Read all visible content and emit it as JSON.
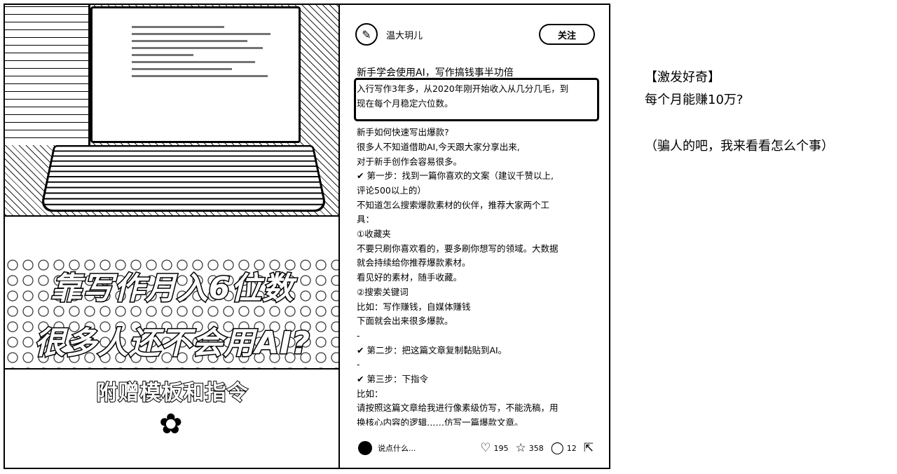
{
  "photo": {
    "overlay_line1": "靠写作月入6位数",
    "overlay_line2": "很多人还不会用AI?",
    "overlay_line3": "附赠模板和指令"
  },
  "post": {
    "author_name": "温大玥儿",
    "follow_label": "关注",
    "title": "新手学会使用AI，写作搞钱事半功倍",
    "body_lines": [
      "入行写作3年多，从2020年刚开始收入从几分几毛，到",
      "现在每个月稳定六位数。",
      "",
      "新手如何快速写出爆款?",
      "很多人不知道借助AI,今天跟大家分享出来,",
      "对于新手创作会容易很多。",
      "✔ 第一步：找到一篇你喜欢的文案（建议千赞以上,",
      "评论500以上的）",
      "不知道怎么搜索爆款素材的伙伴，推荐大家两个工",
      "具：",
      "①收藏夹",
      "不要只刷你喜欢看的，要多刷你想写的领域。大数据",
      "就会持续给你推荐爆款素材。",
      "看见好的素材，随手收藏。",
      "②搜索关键词",
      "比如：写作赚钱，自媒体赚钱",
      "下面就会出来很多爆款。",
      "-",
      "✔ 第二步：把这篇文章复制黏贴到AI。",
      "-",
      "✔ 第三步：下指令",
      "比如：",
      "请按照这篇文章给我进行像素级仿写，不能洗稿，用",
      "换核心内容的逻辑……仿写一篇爆款文章。"
    ],
    "comment_placeholder": "说点什么...",
    "likes": "195",
    "stars": "358",
    "comments": "12"
  },
  "annotation": {
    "line1": "【激发好奇】",
    "line2": "每个月能赚10万?",
    "line3": "（骗人的吧，我来看看怎么个事）"
  }
}
